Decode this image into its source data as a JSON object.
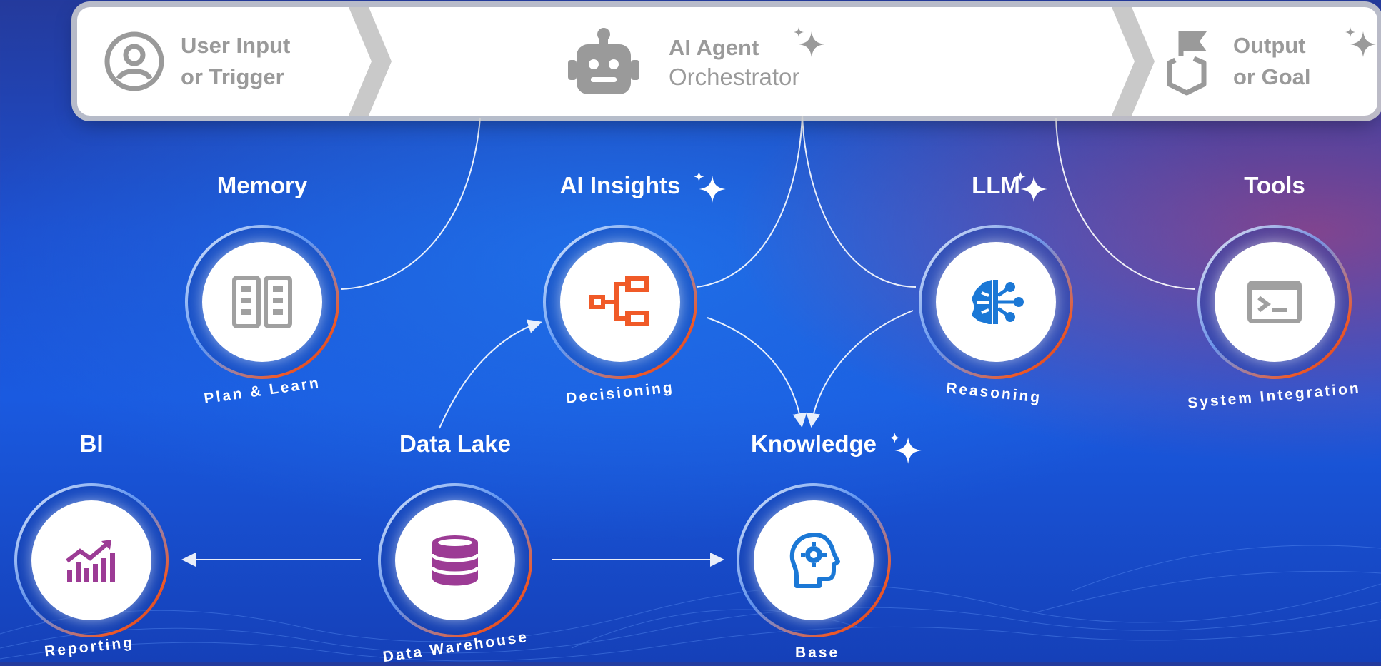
{
  "banner": {
    "input_line1": "User Input",
    "input_line2": "or Trigger",
    "agent_line1": "AI Agent",
    "agent_line2": "Orchestrator",
    "output_line1": "Output",
    "output_line2": "or Goal"
  },
  "nodes": {
    "memory": {
      "title": "Memory",
      "sub": "Plan & Learn"
    },
    "ai_insights": {
      "title": "AI Insights",
      "sub": "Decisioning"
    },
    "llm": {
      "title": "LLM",
      "sub": "Reasoning"
    },
    "tools": {
      "title": "Tools",
      "sub": "System Integration"
    },
    "bi": {
      "title": "BI",
      "sub": "Reporting"
    },
    "data_lake": {
      "title": "Data Lake",
      "sub": "Data Warehouse"
    },
    "knowledge": {
      "title": "Knowledge",
      "sub": "Base"
    }
  },
  "colors": {
    "orange": "#f05a28",
    "blue": "#1b78d6",
    "purple": "#9c3b95",
    "gray": "#9a9a9a"
  }
}
